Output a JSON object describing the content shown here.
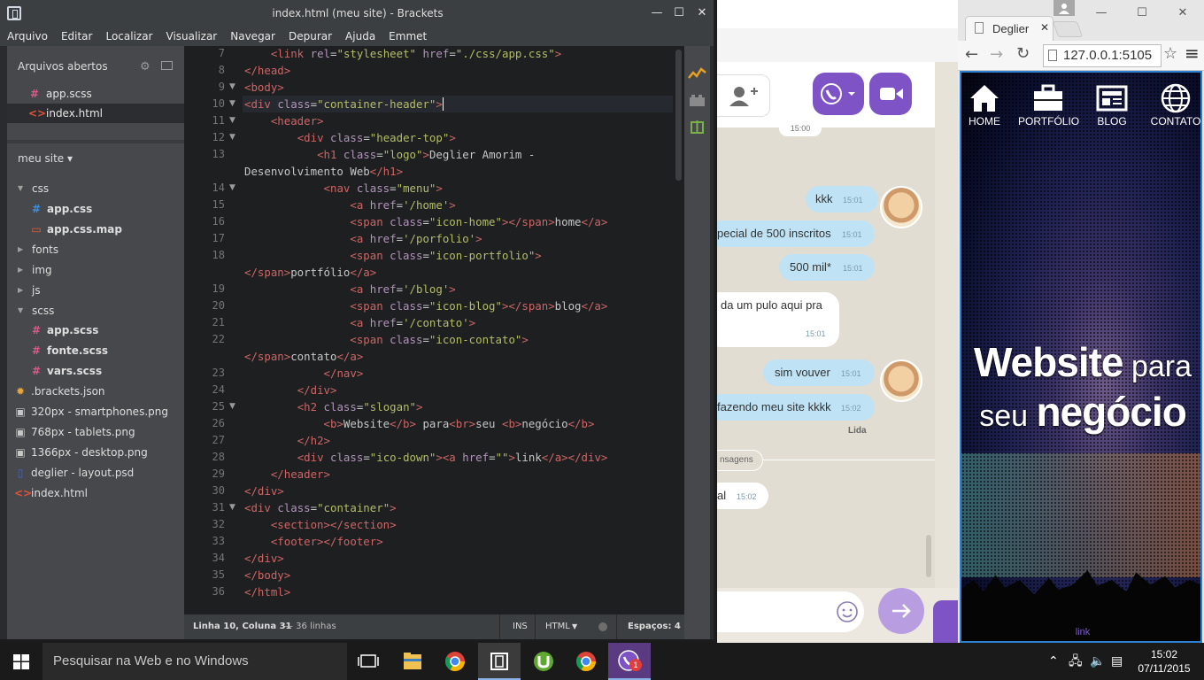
{
  "brackets": {
    "title": "index.html (meu site) - Brackets",
    "menu": [
      "Arquivo",
      "Editar",
      "Localizar",
      "Visualizar",
      "Navegar",
      "Depurar",
      "Ajuda",
      "Emmet"
    ],
    "sidebar": {
      "open_files_header": "Arquivos abertos",
      "open_files": [
        {
          "name": "app.scss",
          "icon": "hash-icon"
        },
        {
          "name": "index.html",
          "icon": "html-icon"
        }
      ],
      "project_name": "meu site ▾",
      "tree": [
        {
          "name": "css"
        },
        {
          "name": "app.css"
        },
        {
          "name": "app.css.map"
        },
        {
          "name": "fonts"
        },
        {
          "name": "img"
        },
        {
          "name": "js"
        },
        {
          "name": "scss"
        },
        {
          "name": "app.scss"
        },
        {
          "name": "fonte.scss"
        },
        {
          "name": "vars.scss"
        },
        {
          "name": ".brackets.json"
        },
        {
          "name": "320px - smartphones.png"
        },
        {
          "name": "768px - tablets.png"
        },
        {
          "name": "1366px - desktop.png"
        },
        {
          "name": "deglier - layout.psd"
        },
        {
          "name": "index.html"
        }
      ]
    },
    "gutter": [
      "7",
      "8",
      "9",
      "10",
      "11",
      "12",
      "13",
      "",
      "14",
      "15",
      "16",
      "17",
      "18",
      "",
      "19",
      "20",
      "21",
      "22",
      "",
      "23",
      "24",
      "25",
      "26",
      "27",
      "28",
      "29",
      "30",
      "31",
      "32",
      "33",
      "34",
      "35",
      "36"
    ],
    "status": {
      "position": "Linha 10, Coluna 31",
      "lines": "— 36 linhas",
      "mode": "INS",
      "lang": "HTML",
      "spaces": "Espaços: 4"
    }
  },
  "viber": {
    "messages": [
      {
        "text": "kkk",
        "time": "15:01"
      },
      {
        "text": "pecial de 500 inscritos",
        "time": "15:01"
      },
      {
        "text": "500 mil*",
        "time": "15:01"
      },
      {
        "text": "da um pulo aqui pra",
        "time": "15:01"
      },
      {
        "text": "sim vouver",
        "time": "15:01"
      },
      {
        "text": "fazendo meu site kkkk",
        "time": "15:02"
      },
      {
        "text": "al",
        "time": "15:02"
      }
    ],
    "top_time": "15:00",
    "seen": "Lida",
    "divider": "nsagens"
  },
  "browser": {
    "tab_title": "Deglier",
    "url": "127.0.0.1:5105",
    "nav": [
      "HOME",
      "PORTFÓLIO",
      "BLOG",
      "CONTATO"
    ],
    "slogan_bold_1": "Website",
    "slogan_1": " para",
    "slogan_2": "seu ",
    "slogan_bold_2": "negócio",
    "link": "link"
  },
  "taskbar": {
    "search_placeholder": "Pesquisar na Web e no Windows",
    "time": "15:02",
    "date": "07/11/2015",
    "viber_badge": "1"
  }
}
